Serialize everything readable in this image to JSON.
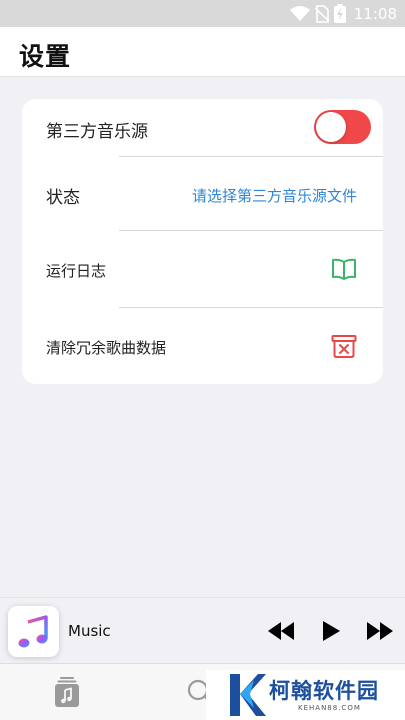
{
  "status_bar": {
    "time": "11:08",
    "icons": [
      "wifi-icon",
      "no-sim-icon",
      "battery-charging-icon"
    ]
  },
  "header": {
    "title": "设置"
  },
  "settings": {
    "third_party_source_label": "第三方音乐源",
    "third_party_source_enabled": true,
    "status_label": "状态",
    "status_value": "请选择第三方音乐源文件",
    "log_label": "运行日志",
    "clean_label": "清除冗余歌曲数据"
  },
  "player": {
    "track_title": "Music",
    "controls": [
      "rewind-icon",
      "play-icon",
      "fast-forward-icon"
    ]
  },
  "tab_bar": {
    "tabs": [
      "library-icon",
      "search-icon"
    ]
  },
  "watermark": {
    "text": "柯翰软件园",
    "subtext": "KEHAN88.COM"
  },
  "colors": {
    "accent_red": "#f04848",
    "link_blue": "#2f86d6",
    "log_icon_green": "#3bb36a",
    "clean_icon_red": "#e84848",
    "background": "#f1f0f5"
  }
}
